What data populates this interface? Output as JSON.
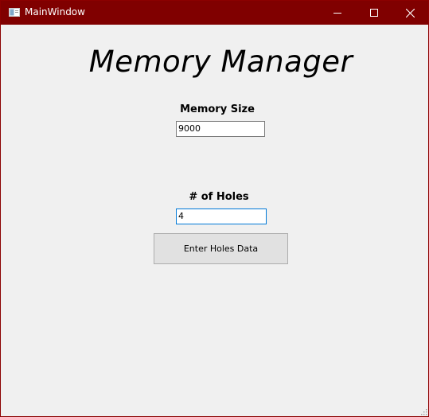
{
  "window": {
    "title": "MainWindow",
    "titlebar_color": "#800000",
    "controls": [
      "minimize-icon",
      "maximize-icon",
      "close-icon"
    ]
  },
  "main": {
    "heading": "Memory Manager",
    "memory_size": {
      "label": "Memory Size",
      "value": "9000"
    },
    "holes": {
      "label": "# of Holes",
      "value": "4"
    },
    "enter_button_label": "Enter Holes Data"
  }
}
